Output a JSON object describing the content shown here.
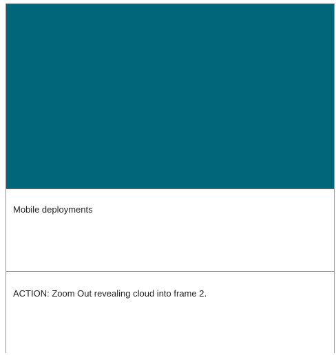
{
  "storyboard": {
    "frame_color": "#02667b",
    "caption": "Mobile deployments",
    "action": "ACTION: Zoom Out revealing cloud into frame 2."
  }
}
